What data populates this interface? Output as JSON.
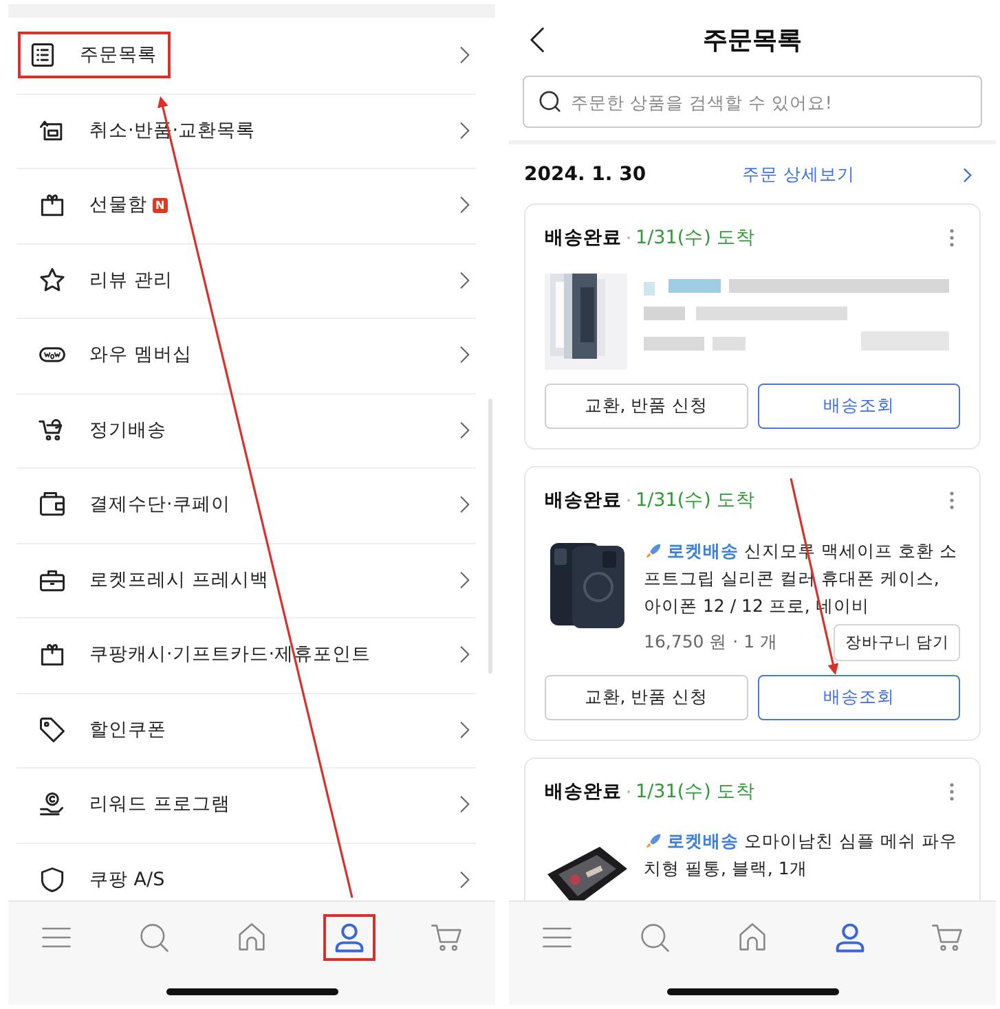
{
  "left_screen": {
    "menu_items": [
      {
        "label": "주문목록",
        "highlighted": true
      },
      {
        "label": "취소·반품·교환목록",
        "highlighted": false
      },
      {
        "label": "선물함",
        "badge": "N",
        "highlighted": false
      },
      {
        "label": "리뷰 관리",
        "highlighted": false
      },
      {
        "label": "와우 멤버십",
        "highlighted": false
      },
      {
        "label": "정기배송",
        "highlighted": false
      },
      {
        "label": "결제수단·쿠페이",
        "highlighted": false
      },
      {
        "label": "로켓프레시 프레시백",
        "highlighted": false
      },
      {
        "label": "쿠팡캐시·기프트카드·제휴포인트",
        "highlighted": false
      },
      {
        "label": "할인쿠폰",
        "highlighted": false
      },
      {
        "label": "리워드 프로그램",
        "highlighted": false
      },
      {
        "label": "쿠팡 A/S",
        "highlighted": false
      }
    ],
    "tab_bar": [
      {
        "kind": "menu",
        "selected": false,
        "highlighted": false
      },
      {
        "kind": "search",
        "selected": false,
        "highlighted": false
      },
      {
        "kind": "home",
        "selected": false,
        "highlighted": false
      },
      {
        "kind": "account",
        "selected": true,
        "highlighted": true
      },
      {
        "kind": "cart",
        "selected": false,
        "highlighted": false
      }
    ]
  },
  "right_screen": {
    "title": "주문목록",
    "search": {
      "placeholder": "주문한 상품을 검색할 수 있어요!"
    },
    "order_date": "2024. 1. 30",
    "detail_link": "주문 상세보기",
    "orders": [
      {
        "kind": "blurred",
        "status": "배송완료",
        "arrival": "1/31(수) 도착",
        "buttons": [
          "교환, 반품 신청",
          "배송조회"
        ]
      },
      {
        "kind": "case",
        "status": "배송완료",
        "arrival": "1/31(수) 도착",
        "delivery_tag": "로켓배송",
        "product_name": "신지모루 맥세이프 호환 소프트그립 실리콘 컬러 휴대폰 케이스, 아이폰 12 / 12 프로, 네이비",
        "price": "16,750 원 · 1 개",
        "cart_button": "장바구니 담기",
        "buttons": [
          "교환, 반품 신청",
          "배송조회"
        ]
      },
      {
        "kind": "pouch",
        "status": "배송완료",
        "arrival": "1/31(수) 도착",
        "delivery_tag": "로켓배송",
        "product_name": "오마이남친 심플 메쉬 파우치형 필통, 블랙, 1개"
      }
    ],
    "tab_bar": [
      {
        "kind": "menu",
        "selected": false,
        "highlighted": false
      },
      {
        "kind": "search",
        "selected": false,
        "highlighted": false
      },
      {
        "kind": "home",
        "selected": false,
        "highlighted": false
      },
      {
        "kind": "account",
        "selected": true,
        "highlighted": false
      },
      {
        "kind": "cart",
        "selected": false,
        "highlighted": false
      }
    ]
  }
}
